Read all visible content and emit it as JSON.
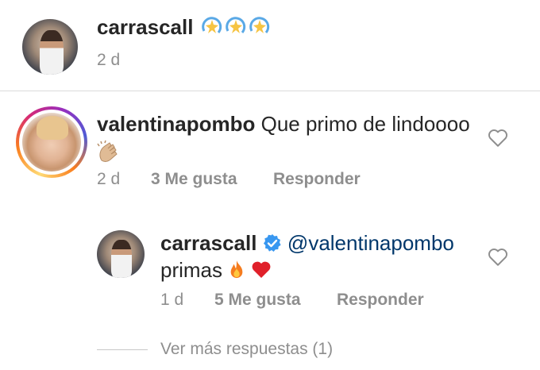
{
  "comment1": {
    "username": "carrascall",
    "emojis": [
      "dizzy-star-icon",
      "dizzy-star-icon",
      "dizzy-star-icon"
    ],
    "time": "2 d"
  },
  "comment2": {
    "username": "valentinapombo",
    "text": "Que primo de lindoooo",
    "emoji": "clapping-hands-icon",
    "time": "2 d",
    "likes": "3 Me gusta",
    "reply_label": "Responder"
  },
  "reply1": {
    "username": "carrascall",
    "verified": "verified-badge-icon",
    "mention": "@valentinapombo",
    "text": "primas",
    "emojis": [
      "fire-icon",
      "red-heart-icon"
    ],
    "time": "1 d",
    "likes": "5 Me gusta",
    "reply_label": "Responder"
  },
  "more_replies": "Ver más respuestas (1)",
  "colors": {
    "text": "#262626",
    "meta": "#8e8e8e",
    "mention": "#00376b",
    "verified": "#3897f0"
  }
}
